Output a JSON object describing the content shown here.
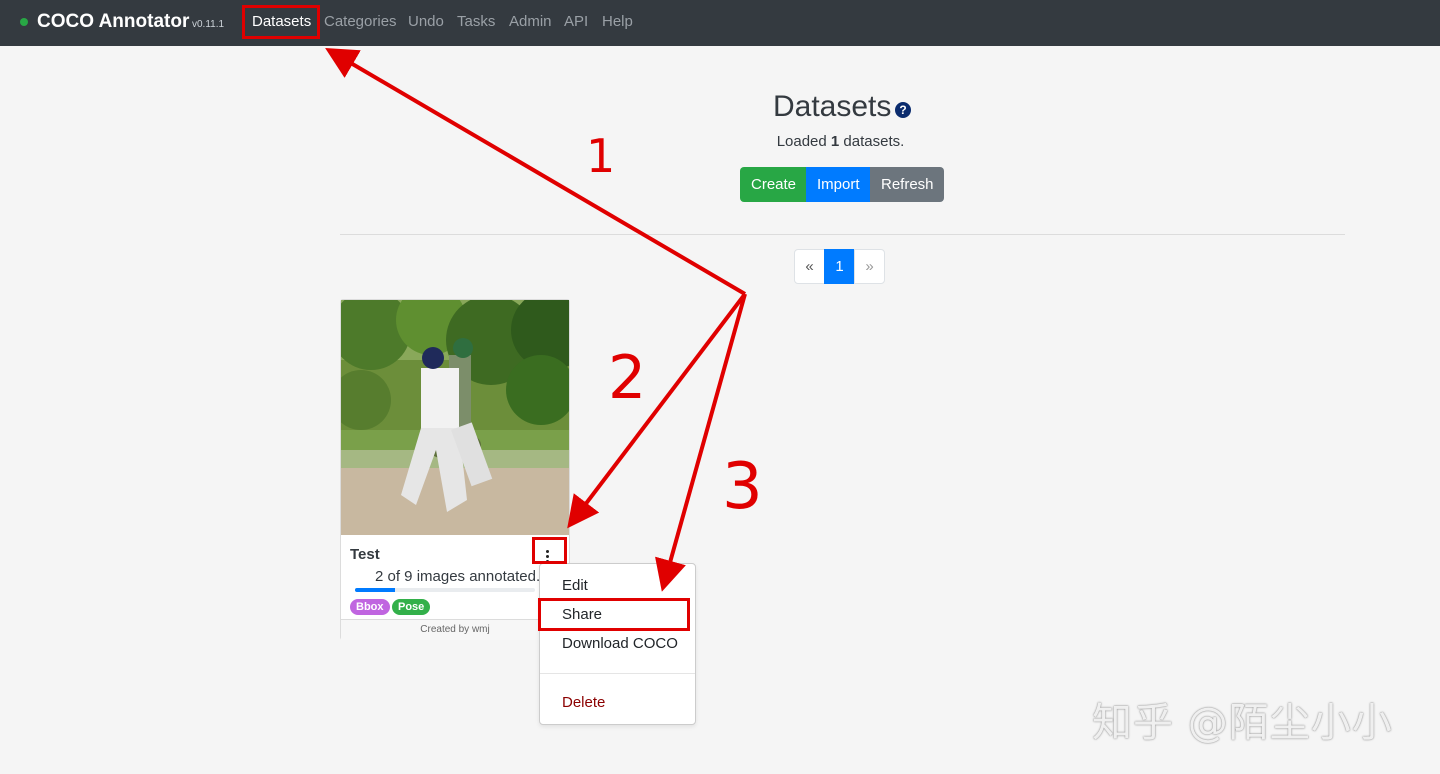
{
  "navbar": {
    "brand": "COCO Annotator",
    "version": "v0.11.1",
    "items": [
      {
        "label": "Datasets",
        "active": true
      },
      {
        "label": "Categories"
      },
      {
        "label": "Undo"
      },
      {
        "label": "Tasks"
      },
      {
        "label": "Admin"
      },
      {
        "label": "API"
      },
      {
        "label": "Help"
      }
    ]
  },
  "header": {
    "title": "Datasets",
    "help_icon": "question-circle-icon",
    "loaded_prefix": "Loaded ",
    "loaded_count": "1",
    "loaded_suffix": " datasets."
  },
  "actions": {
    "create": "Create",
    "import": "Import",
    "refresh": "Refresh"
  },
  "pagination": {
    "prev": "«",
    "current": "1",
    "next": "»"
  },
  "dataset_card": {
    "name": "Test",
    "progress_text": "2 of 9 images annotated.",
    "annotated": 2,
    "total": 9,
    "tags": [
      "Bbox",
      "Pose"
    ],
    "created_by": "Created by wmj"
  },
  "dropdown": {
    "items": [
      "Edit",
      "Share",
      "Download COCO"
    ],
    "delete": "Delete"
  },
  "annotations": {
    "step1": "1",
    "step2": "2",
    "step3": "3",
    "color": "#e00000"
  },
  "watermark": "知乎 @陌尘小小"
}
